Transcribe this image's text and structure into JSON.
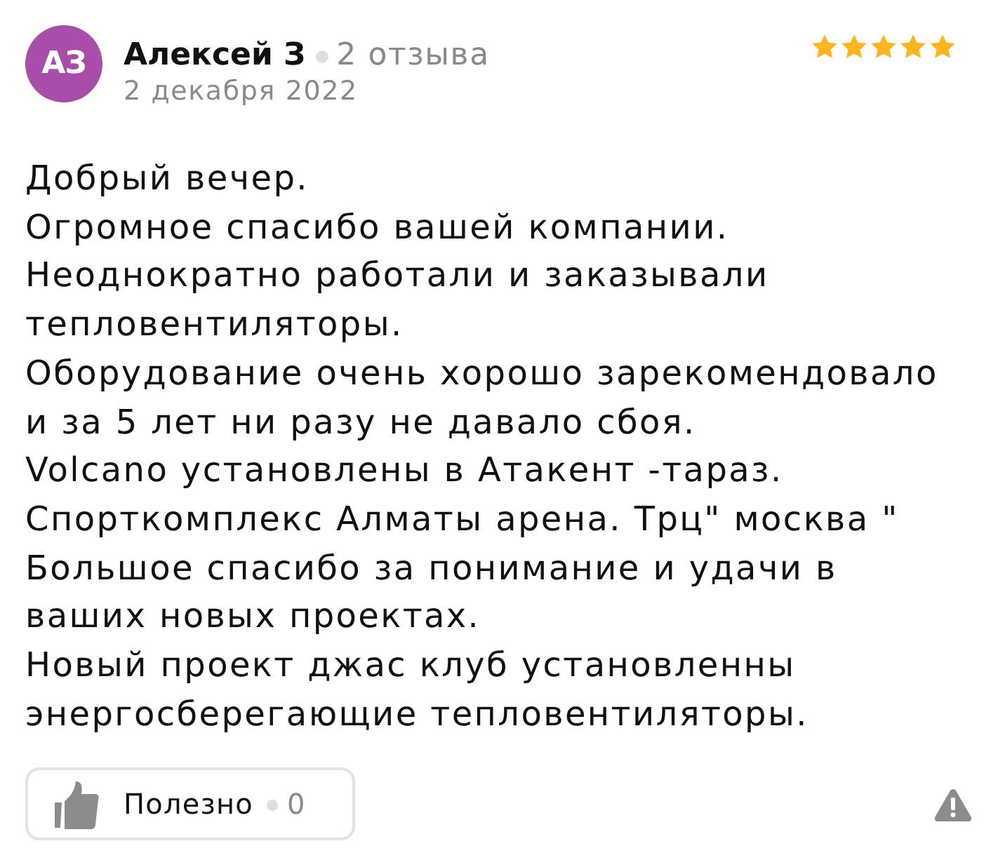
{
  "review": {
    "author": {
      "initials": "АЗ",
      "name": "Алексей З",
      "reviews_count": "2 отзыва"
    },
    "date": "2 декабря 2022",
    "stars": 5,
    "text": "Добрый вечер.\nОгромное спасибо вашей компании.\nНеоднократно работали и заказывали\nтепловентиляторы.\nОборудование очень хорошо зарекомендовало\nи за 5 лет ни разу не давало сбоя.\nVolcano установлены в Атакент -тараз.\nСпорткомплекс Алматы арена. Трц\" москва \"\nБольшое спасибо за понимание и удачи в\nваших новых проектах.\nНовый проект джас клуб установленны\nэнергосберегающие тепловентиляторы.",
    "helpful": {
      "label": "Полезно",
      "count": "0"
    }
  }
}
